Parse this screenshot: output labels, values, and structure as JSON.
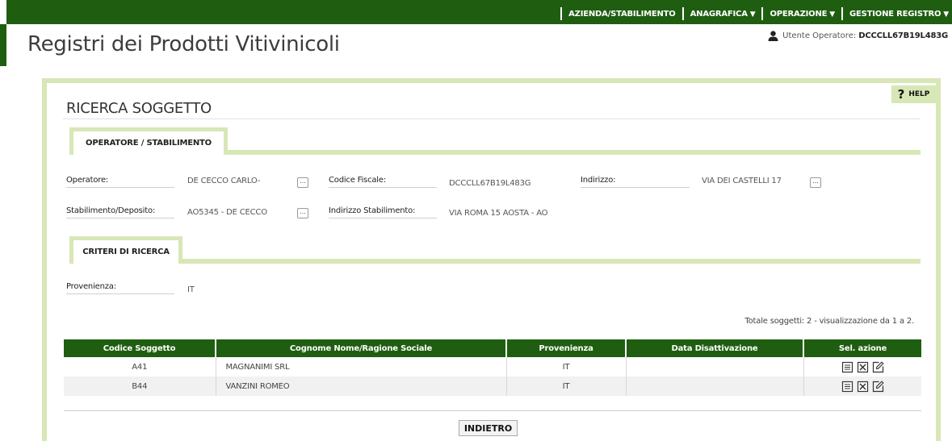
{
  "nav": {
    "items": [
      {
        "label": "AZIENDA/STABILIMENTO",
        "arrow": ""
      },
      {
        "label": "ANAGRAFICA",
        "arrow": "▼"
      },
      {
        "label": "OPERAZIONE",
        "arrow": "▼"
      },
      {
        "label": "GESTIONE REGISTRO",
        "arrow": "▼"
      }
    ]
  },
  "app": {
    "title": "Registri dei Prodotti Vitivinicoli"
  },
  "user": {
    "label": "Utente Operatore:",
    "code": "DCCCLL67B19L483G",
    "icon": "user-icon"
  },
  "help": {
    "q": "?",
    "label": "HELP"
  },
  "page": {
    "title": "RICERCA SOGGETTO"
  },
  "operatore": {
    "tab": "OPERATORE / STABILIMENTO",
    "operatore_label": "Operatore:",
    "operatore_value": "DE CECCO CARLO-",
    "cf_label": "Codice Fiscale:",
    "cf_value": "DCCCLL67B19L483G",
    "indirizzo_label": "Indirizzo:",
    "indirizzo_value": "VIA DEI CASTELLI 17",
    "stab_label": "Stabilimento/Deposito:",
    "stab_value": "AO5345 - DE CECCO",
    "ind_stab_label": "Indirizzo Stabilimento:",
    "ind_stab_value": "VIA ROMA 15 AOSTA -  AO",
    "lookup": "..."
  },
  "criteri": {
    "tab": "CRITERI DI RICERCA",
    "provenienza_label": "Provenienza:",
    "provenienza_value": "IT"
  },
  "results": {
    "total": "Totale soggetti: 2 - visualizzazione da 1 a 2.",
    "columns": [
      "Codice Soggetto",
      "Cognome Nome/Ragione Sociale",
      "Provenienza",
      "Data Disattivazione",
      "Sel. azione"
    ],
    "rows": [
      {
        "codice": "A41",
        "nome": "MAGNANIMI SRL",
        "provenienza": "IT",
        "data": ""
      },
      {
        "codice": "B44",
        "nome": "VANZINI ROMEO",
        "provenienza": "IT",
        "data": ""
      }
    ],
    "action_icons": [
      "detail-icon",
      "delete-icon",
      "edit-icon"
    ]
  },
  "buttons": {
    "back": "INDIETRO"
  },
  "colors": {
    "primary_green": "#1f5e10",
    "light_green": "#d7e7b6"
  }
}
